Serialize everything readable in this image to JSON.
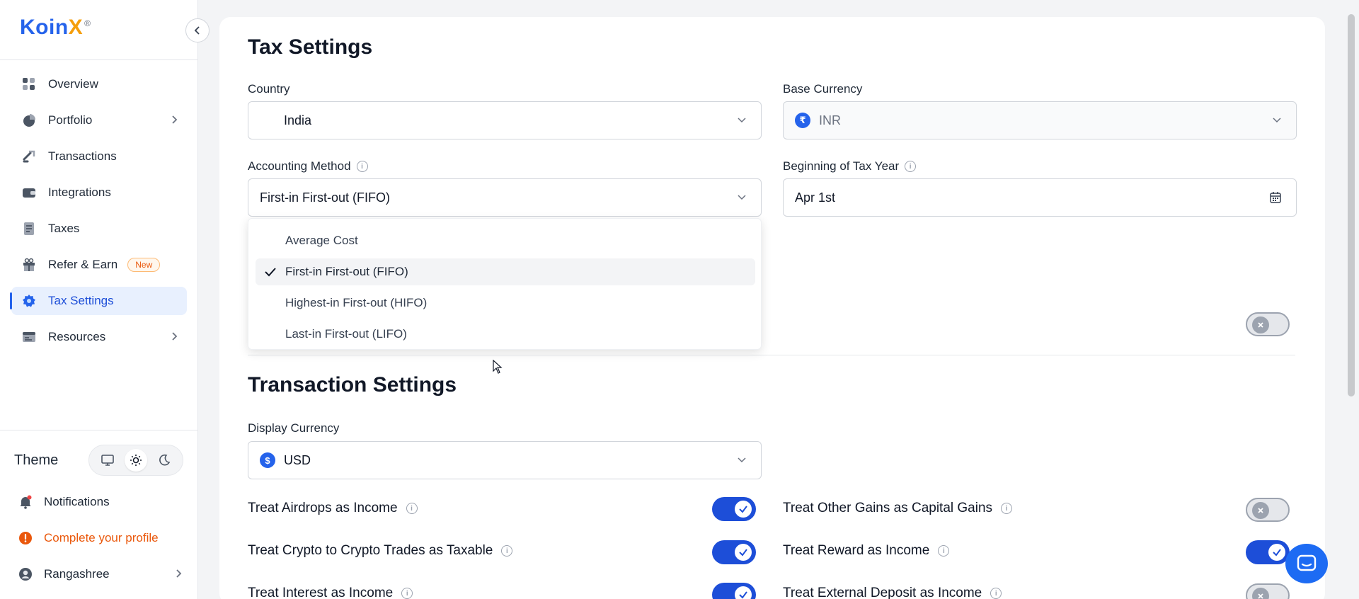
{
  "app": {
    "brand_name": "KoinX",
    "brand_main": "Koin",
    "brand_x": "X",
    "registered_mark": "®"
  },
  "sidebar": {
    "items": [
      {
        "label": "Overview",
        "icon": "grid-icon"
      },
      {
        "label": "Portfolio",
        "icon": "pie-chart-icon"
      },
      {
        "label": "Transactions",
        "icon": "transfer-icon"
      },
      {
        "label": "Integrations",
        "icon": "wallet-icon"
      },
      {
        "label": "Taxes",
        "icon": "document-icon"
      },
      {
        "label": "Refer & Earn",
        "icon": "gift-icon",
        "badge": "New"
      },
      {
        "label": "Tax Settings",
        "icon": "gear-icon",
        "active": true
      },
      {
        "label": "Resources",
        "icon": "resources-icon"
      }
    ],
    "theme_label": "Theme",
    "theme_options": [
      "desktop-icon",
      "sun-icon",
      "moon-icon"
    ],
    "theme_selected": "sun-icon",
    "notifications_label": "Notifications",
    "complete_profile_label": "Complete your profile",
    "user_name": "Rangashree"
  },
  "tax_settings": {
    "title": "Tax Settings",
    "country_label": "Country",
    "country_value": "India",
    "base_currency_label": "Base Currency",
    "base_currency_value": "INR",
    "base_currency_symbol": "₹",
    "accounting_method_label": "Accounting Method",
    "accounting_method_value": "First-in First-out (FIFO)",
    "tax_year_label": "Beginning of Tax Year",
    "tax_year_value": "Apr 1st",
    "hidden_toggle_on": false
  },
  "accounting_dropdown": {
    "options": [
      "Average Cost",
      "First-in First-out (FIFO)",
      "Highest-in First-out (HIFO)",
      "Last-in First-out (LIFO)"
    ],
    "selected_index": 1
  },
  "transaction_settings": {
    "title": "Transaction Settings",
    "display_currency_label": "Display Currency",
    "display_currency_value": "USD",
    "display_currency_symbol": "$",
    "left_options": [
      {
        "label": "Treat Airdrops as Income",
        "on": true
      },
      {
        "label": "Treat Crypto to Crypto Trades as Taxable",
        "on": true
      },
      {
        "label": "Treat Interest as Income",
        "on": true
      }
    ],
    "right_options": [
      {
        "label": "Treat Other Gains as Capital Gains",
        "on": false
      },
      {
        "label": "Treat Reward as Income",
        "on": true
      },
      {
        "label": "Treat External Deposit as Income",
        "on": false
      }
    ]
  },
  "colors": {
    "accent": "#1d4ed8",
    "brand_blue": "#2563eb",
    "brand_orange": "#f59e0b",
    "warning": "#ea580c"
  }
}
